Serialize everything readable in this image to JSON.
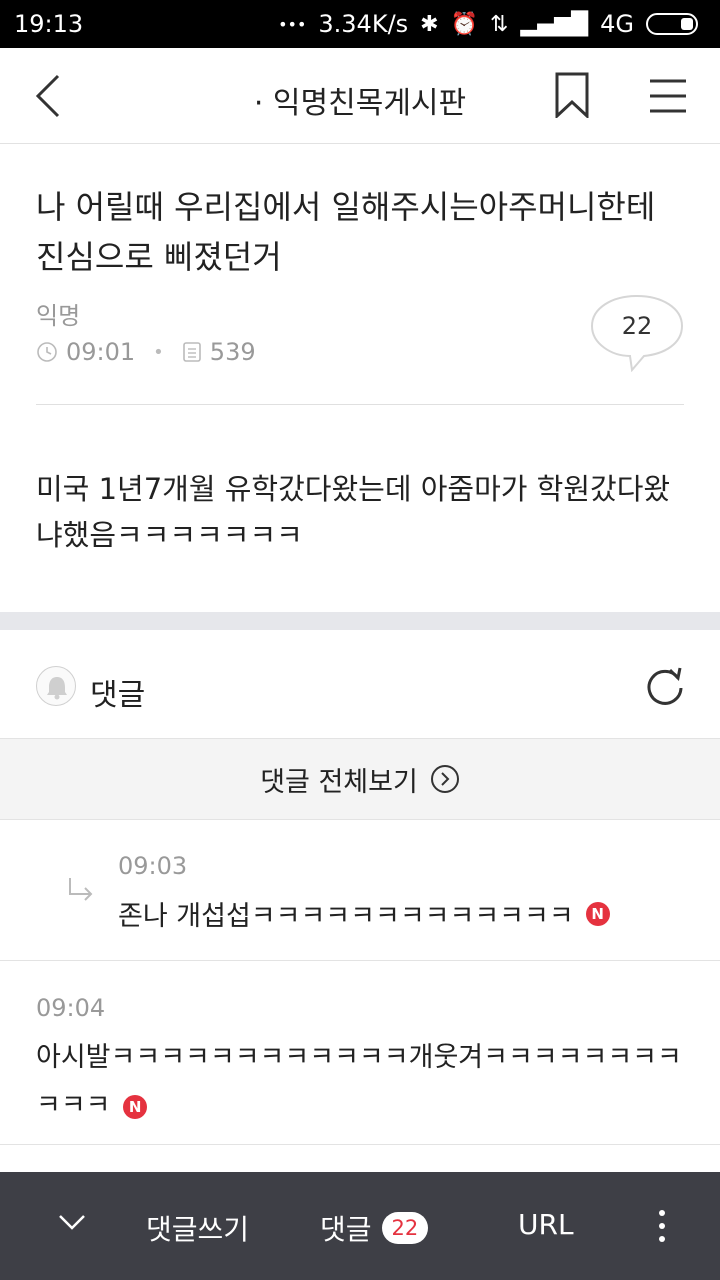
{
  "status_bar": {
    "time": "19:13",
    "speed": "3.34K/s",
    "network": "4G",
    "dots": "•••"
  },
  "header": {
    "title": "· 익명친목게시판"
  },
  "post": {
    "title": "나 어릴때 우리집에서 일해주시는아주머니한테 진심으로 삐졌던거",
    "author": "익명",
    "time": "09:01",
    "views": "539",
    "comment_count": "22",
    "body": "미국 1년7개월 유학갔다왔는데 아줌마가 학원갔다왔냐했음ㅋㅋㅋㅋㅋㅋㅋ"
  },
  "comments_section": {
    "label": "댓글",
    "view_all": "댓글 전체보기",
    "items": [
      {
        "time": "09:03",
        "text": "존나 개섭섭ㅋㅋㅋㅋㅋㅋㅋㅋㅋㅋㅋㅋㅋ",
        "badge": "N"
      },
      {
        "time": "09:04",
        "text": "아시발ㅋㅋㅋㅋㅋㅋㅋㅋㅋㅋㅋㅋ개웃겨ㅋㅋㅋㅋㅋㅋㅋㅋㅋㅋㅋ",
        "badge": "N"
      }
    ]
  },
  "bottom_bar": {
    "write_label": "댓글쓰기",
    "comments_label": "댓글",
    "comments_count": "22",
    "url_label": "URL"
  },
  "colors": {
    "accent": "#e5323f",
    "bottom_bar": "#3e3f46"
  }
}
